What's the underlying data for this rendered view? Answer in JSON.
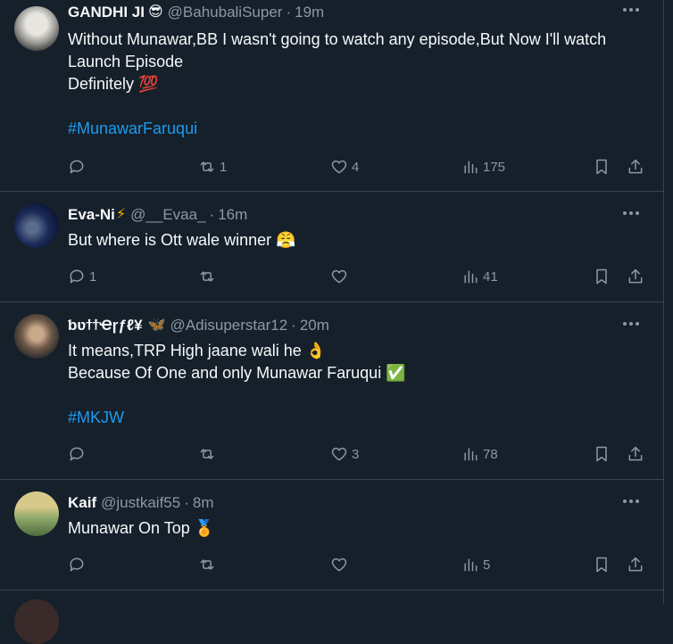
{
  "tweets": [
    {
      "name": "GANDHI JI",
      "name_emoji": "😎",
      "handle": "@BahubaliSuper",
      "time": "19m",
      "lines": [
        "Without Munawar,BB I wasn't going to watch any episode,But Now I'll watch",
        "Launch Episode",
        "Definitely 💯"
      ],
      "hashtag": "#MunawarFaruqui",
      "replies": "",
      "retweets": "1",
      "likes": "4",
      "views": "175"
    },
    {
      "name": "Eva-Ni",
      "name_emoji": "⚡",
      "handle": "@__Evaa_",
      "time": "16m",
      "lines": [
        "But where is Ott wale winner 😤"
      ],
      "hashtag": "",
      "replies": "1",
      "retweets": "",
      "likes": "",
      "views": "41"
    },
    {
      "name": "ƅʋϯϯҼɼƒℓ¥",
      "name_emoji": "🦋",
      "handle": "@Adisuperstar12",
      "time": "20m",
      "lines": [
        "It means,TRP High jaane wali he 👌",
        "Because Of One and only Munawar Faruqui ✅"
      ],
      "hashtag": "#MKJW",
      "replies": "",
      "retweets": "",
      "likes": "3",
      "views": "78"
    },
    {
      "name": "Kaif",
      "name_emoji": "",
      "handle": "@justkaif55",
      "time": "8m",
      "lines": [
        "Munawar On Top 🏅"
      ],
      "hashtag": "",
      "replies": "",
      "retweets": "",
      "likes": "",
      "views": "5"
    }
  ],
  "separator": "·",
  "colors": {
    "background": "#15202b",
    "text": "#f7f9f9",
    "muted": "#8b98a5",
    "link": "#1d9bf0",
    "border": "#38444d"
  },
  "icons": [
    "reply-icon",
    "retweet-icon",
    "like-icon",
    "views-icon",
    "bookmark-icon",
    "share-icon",
    "more-icon"
  ]
}
